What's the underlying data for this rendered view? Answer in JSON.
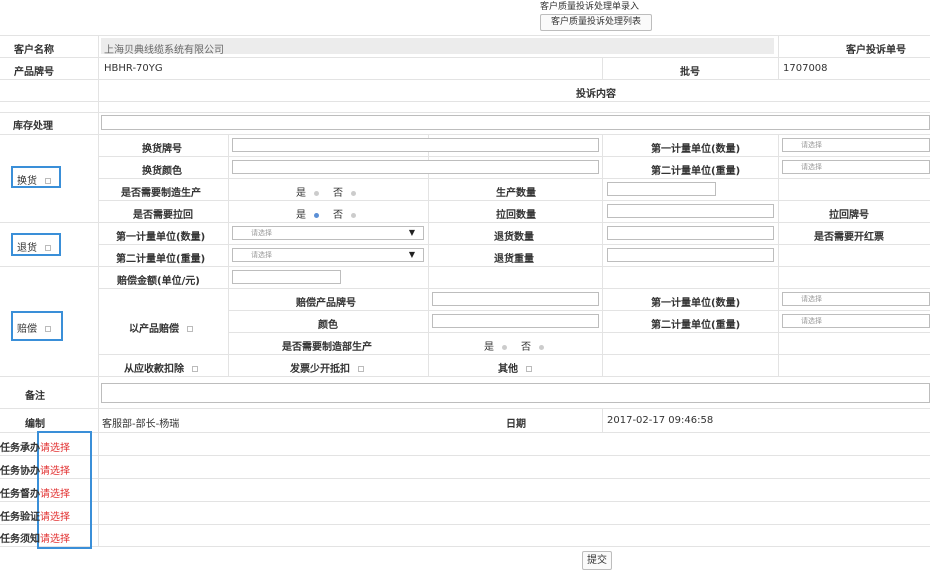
{
  "header": {
    "title": "客户质量投诉处理单录入",
    "list_button": "客户质量投诉处理列表"
  },
  "row1": {
    "customer_label": "客户名称",
    "customer_value": "上海贝典线缆系统有限公司",
    "complaint_no_label": "客户投诉单号"
  },
  "row2": {
    "brand_label": "产品牌号",
    "brand_value": "HBHR-70YG",
    "batch_label": "批号",
    "batch_value": "1707008"
  },
  "row3": {
    "content_label": "投诉内容"
  },
  "stock": {
    "label": "库存处理"
  },
  "exchange": {
    "group_label": "换货",
    "brand_label": "换货牌号",
    "color_label": "换货颜色",
    "unit1_label": "第一计量单位(数量)",
    "unit2_label": "第二计量单位(重量)",
    "select_placeholder": "请选择",
    "manufacture_label": "是否需要制造生产",
    "yes": "是",
    "no": "否",
    "qty_label": "生产数量",
    "recall_label": "是否需要拉回",
    "recall_qty_label": "拉回数量",
    "recall_brand_label": "拉回牌号"
  },
  "return": {
    "group_label": "退货",
    "unit1_label": "第一计量单位(数量)",
    "unit2_label": "第二计量单位(重量)",
    "select_placeholder": "请选择",
    "qty_label": "退货数量",
    "weight_label": "退货重量",
    "red_invoice_label": "是否需要开红票"
  },
  "compensation": {
    "group_label": "赔偿",
    "amount_label": "赔偿金额(单位/元)",
    "by_product_label": "以产品赔偿",
    "product_brand_label": "赔偿产品牌号",
    "color_label": "颜色",
    "unit1_label": "第一计量单位(数量)",
    "unit2_label": "第二计量单位(重量)",
    "select_placeholder": "请选择",
    "manufacture_label": "是否需要制造部生产",
    "yes": "是",
    "no": "否",
    "deduct_label": "从应收款扣除",
    "invoice_label": "发票少开抵扣",
    "other_label": "其他"
  },
  "remark": {
    "label": "备注"
  },
  "editor": {
    "label": "编制",
    "value": "客服部-部长-杨瑞",
    "date_label": "日期",
    "date_value": "2017-02-17 09:46:58"
  },
  "tasks": [
    {
      "label": "任务承办",
      "action": "请选择"
    },
    {
      "label": "任务协办",
      "action": "请选择"
    },
    {
      "label": "任务督办",
      "action": "请选择"
    },
    {
      "label": "任务验证",
      "action": "请选择"
    },
    {
      "label": "任务须知",
      "action": "请选择"
    }
  ],
  "submit_label": "提交"
}
